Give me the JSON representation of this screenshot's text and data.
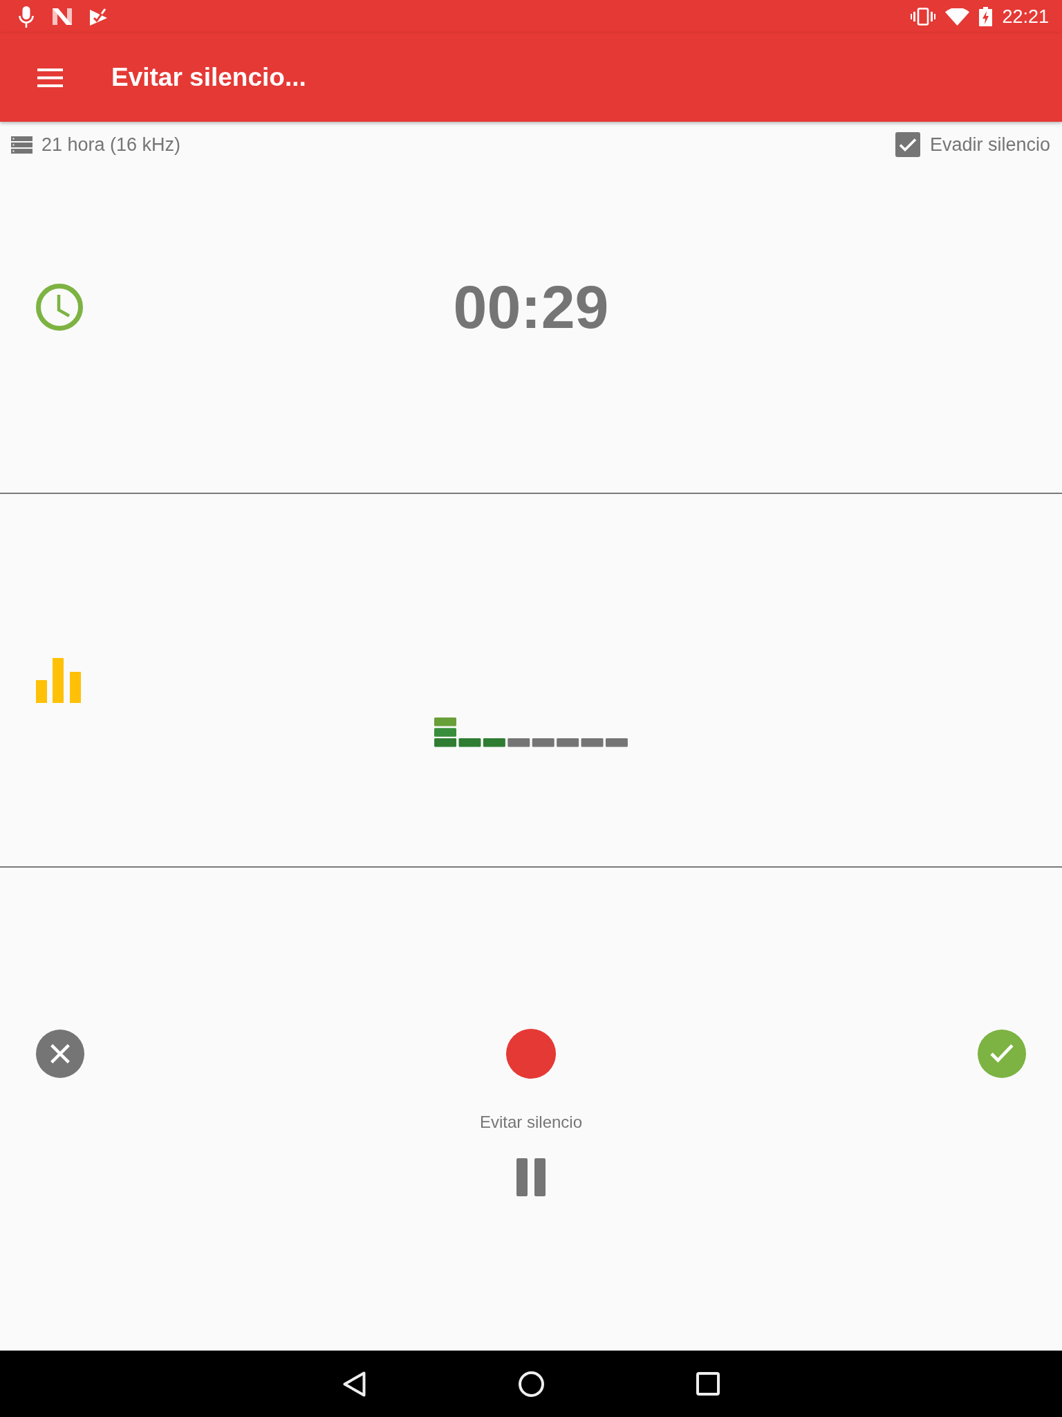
{
  "status_bar": {
    "time": "22:21"
  },
  "app_bar": {
    "title": "Evitar silencio..."
  },
  "info_bar": {
    "storage": "21 hora (16 kHz)",
    "skip_silence": {
      "label": "Evadir silencio",
      "checked": true
    }
  },
  "timer": {
    "elapsed": "00:29"
  },
  "level_meter": {
    "level": 0.375
  },
  "controls": {
    "status_label": "Evitar silencio"
  }
}
